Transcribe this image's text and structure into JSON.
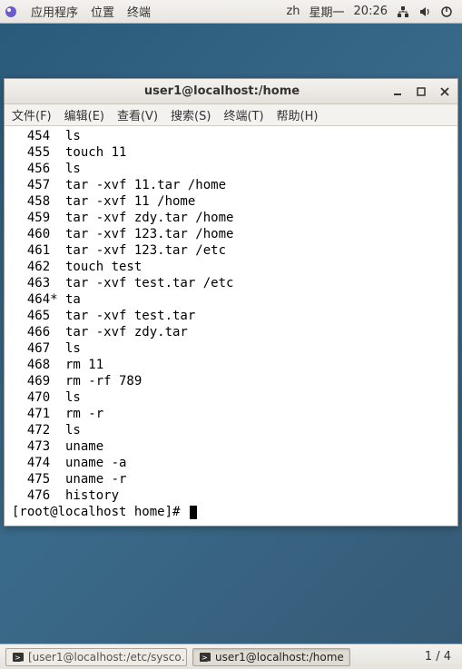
{
  "topbar": {
    "apps_label": "应用程序",
    "places_label": "位置",
    "terminal_label": "终端",
    "lang": "zh",
    "day": "星期一",
    "time": "20:26"
  },
  "window": {
    "title": "user1@localhost:/home",
    "menu": {
      "file": "文件(F)",
      "edit": "编辑(E)",
      "view": "查看(V)",
      "search": "搜索(S)",
      "terminal": "终端(T)",
      "help": "帮助(H)"
    }
  },
  "history": [
    "  454  ls",
    "  455  touch 11",
    "  456  ls",
    "  457  tar -xvf 11.tar /home",
    "  458  tar -xvf 11 /home",
    "  459  tar -xvf zdy.tar /home",
    "  460  tar -xvf 123.tar /home",
    "  461  tar -xvf 123.tar /etc",
    "  462  touch test",
    "  463  tar -xvf test.tar /etc",
    "  464* ta",
    "  465  tar -xvf test.tar",
    "  466  tar -xvf zdy.tar",
    "  467  ls",
    "  468  rm 11",
    "  469  rm -rf 789",
    "  470  ls",
    "  471  rm -r",
    "  472  ls",
    "  473  uname",
    "  474  uname -a",
    "  475  uname -r",
    "  476  history"
  ],
  "prompt": "[root@localhost home]# ",
  "taskbar": {
    "task1": "[user1@localhost:/etc/sysco…",
    "task2": "user1@localhost:/home",
    "workspace": "1 / 4"
  }
}
